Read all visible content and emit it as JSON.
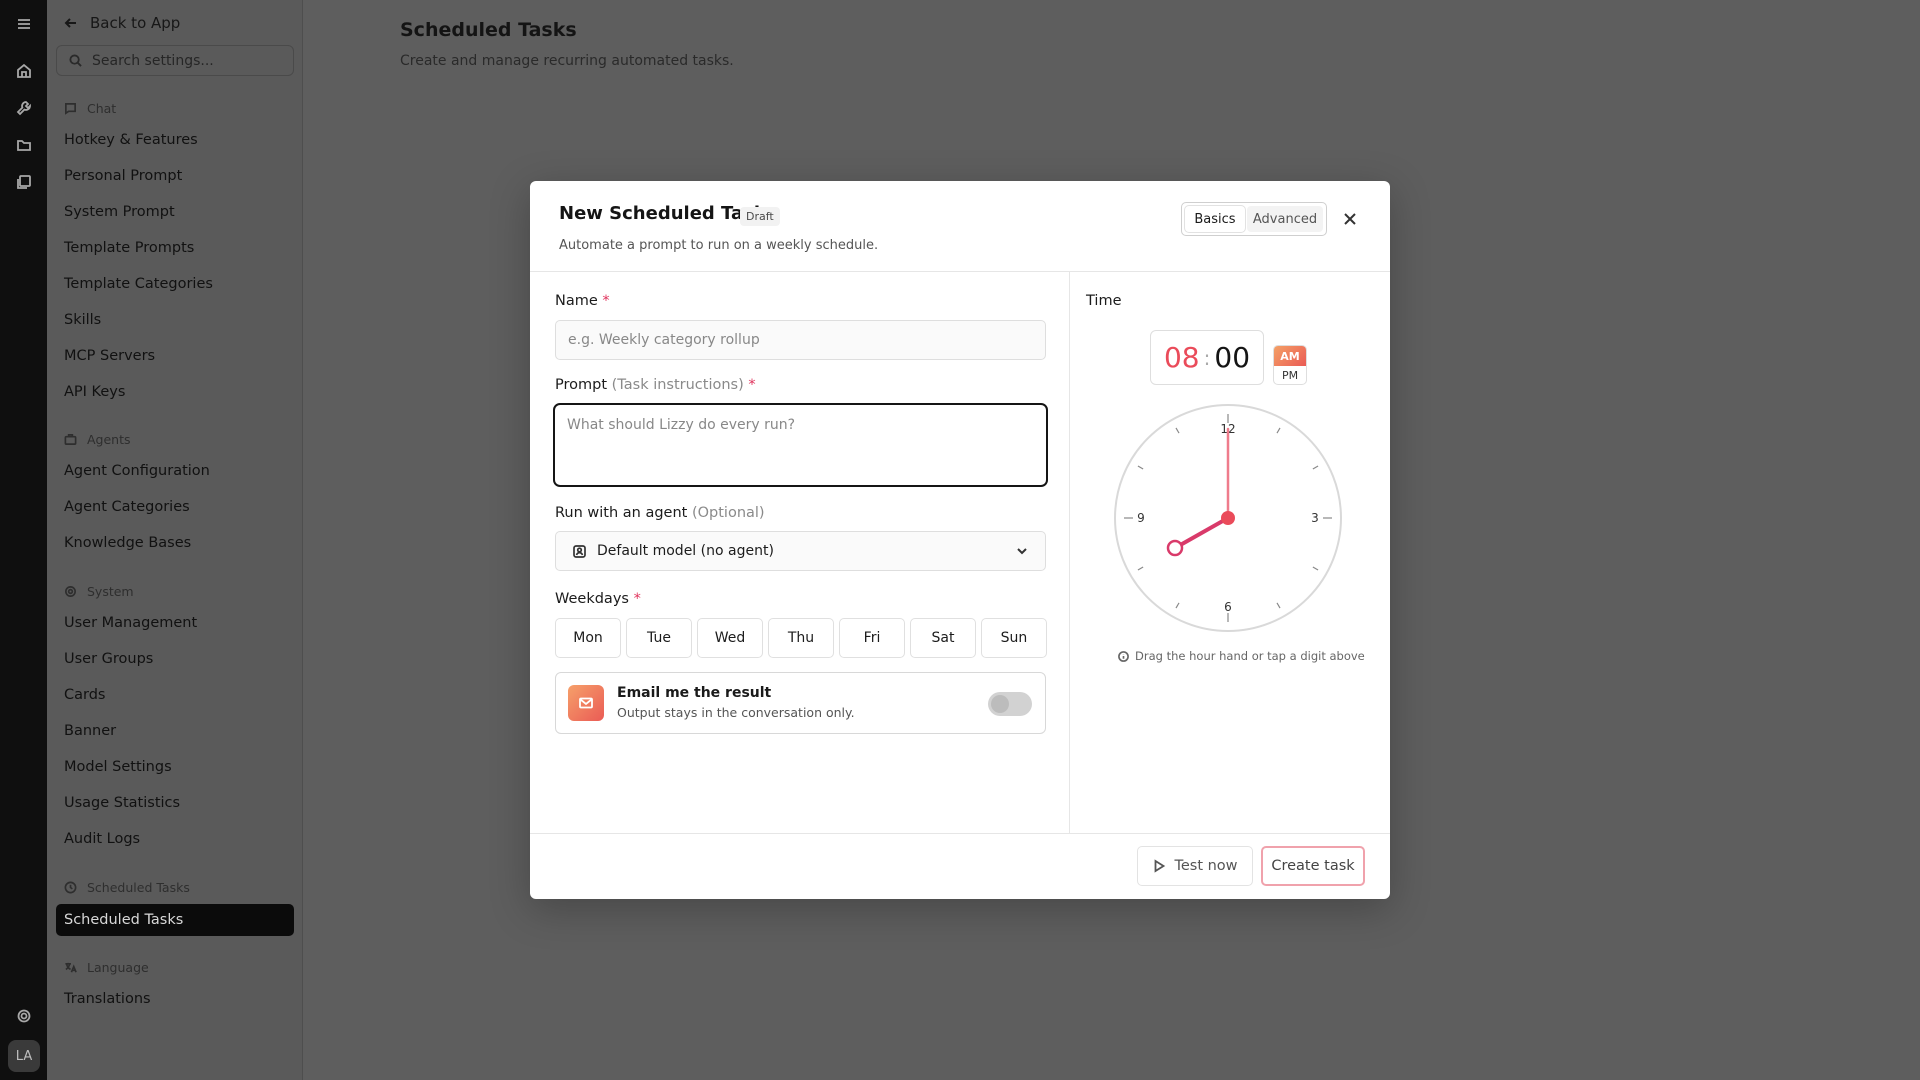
{
  "rail": {
    "avatar_initials": "LA"
  },
  "sidebar": {
    "back_label": "Back to App",
    "search_placeholder": "Search settings...",
    "sections": [
      {
        "label": "Chat",
        "items": [
          "Hotkey & Features",
          "Personal Prompt",
          "System Prompt",
          "Template Prompts",
          "Template Categories",
          "Skills",
          "MCP Servers",
          "API Keys"
        ]
      },
      {
        "label": "Agents",
        "items": [
          "Agent Configuration",
          "Agent Categories",
          "Knowledge Bases"
        ]
      },
      {
        "label": "System",
        "items": [
          "User Management",
          "User Groups",
          "Cards",
          "Banner",
          "Model Settings",
          "Usage Statistics",
          "Audit Logs"
        ]
      },
      {
        "label": "Scheduled Tasks",
        "items": [
          "Scheduled Tasks"
        ]
      },
      {
        "label": "Language",
        "items": [
          "Translations"
        ]
      }
    ],
    "active_item": "Scheduled Tasks"
  },
  "page": {
    "title": "Scheduled Tasks",
    "subtitle": "Create and manage recurring automated tasks."
  },
  "modal": {
    "title": "New Scheduled Task",
    "badge": "Draft",
    "subtitle": "Automate a prompt to run on a weekly schedule.",
    "tabs": {
      "basics": "Basics",
      "advanced": "Advanced"
    },
    "name": {
      "label": "Name",
      "required": "*",
      "placeholder": "e.g. Weekly category rollup"
    },
    "prompt": {
      "label": "Prompt",
      "hint": "(Task instructions)",
      "required": "*",
      "placeholder": "What should Lizzy do every run?"
    },
    "agent": {
      "label": "Run with an agent",
      "hint": "(Optional)",
      "value": "Default model (no agent)"
    },
    "weekdays": {
      "label": "Weekdays",
      "required": "*",
      "days": [
        "Mon",
        "Tue",
        "Wed",
        "Thu",
        "Fri",
        "Sat",
        "Sun"
      ]
    },
    "email": {
      "title": "Email me the result",
      "subtitle": "Output stays in the conversation only.",
      "enabled": false
    },
    "time": {
      "label": "Time",
      "hour": "08",
      "separator": ":",
      "minute": "00",
      "am": "AM",
      "pm": "PM",
      "period_selected": "AM",
      "clock_numbers": {
        "top": "12",
        "right": "3",
        "bottom": "6",
        "left": "9"
      },
      "hint": "Drag the hour hand or tap a digit above"
    },
    "footer": {
      "test_label": "Test now",
      "create_label": "Create task"
    }
  },
  "colors": {
    "accent": "#ea4b5a",
    "accent_gradient_start": "#f4a066",
    "overlay": "#5e5e5e"
  }
}
